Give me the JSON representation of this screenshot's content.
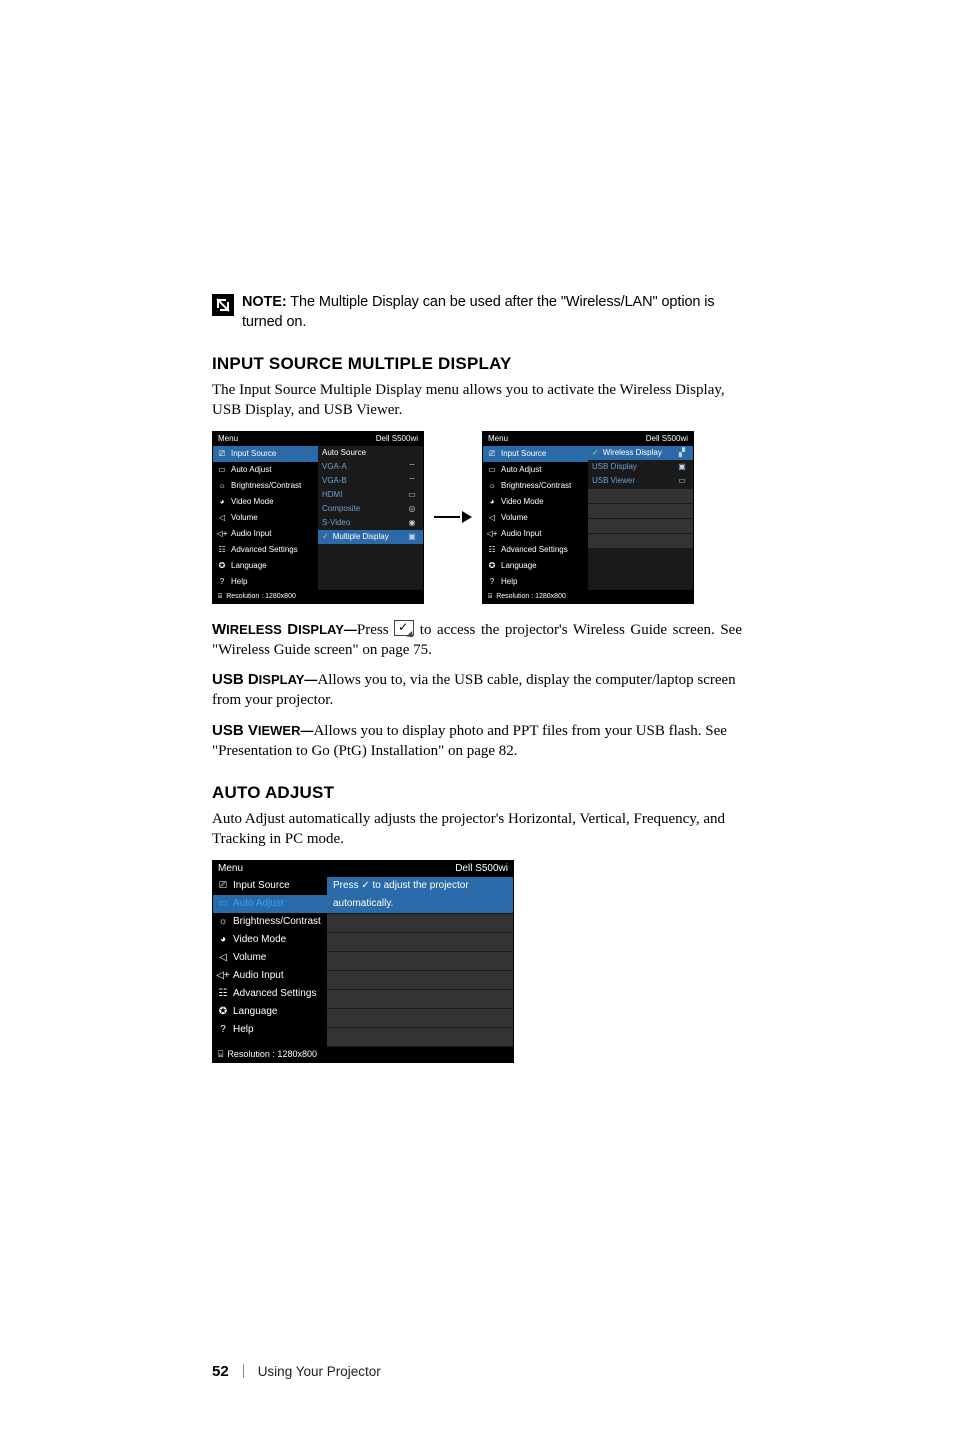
{
  "note": {
    "label": "NOTE:",
    "text": " The Multiple Display can be used after the \"Wireless/LAN\" option is turned on."
  },
  "section1": {
    "heading": "INPUT SOURCE MULTIPLE DISPLAY",
    "para": "The Input Source Multiple Display menu allows you to activate the Wireless Display, USB Display, and USB Viewer."
  },
  "osd_common": {
    "menu_title": "Menu",
    "model": "Dell  S500wi",
    "resolution": "Resolution : 1280x800",
    "sidebar": [
      "Input Source",
      "Auto Adjust",
      "Brightness/Contrast",
      "Video Mode",
      "Volume",
      "Audio Input",
      "Advanced Settings",
      "Language",
      "Help"
    ]
  },
  "osd_left": {
    "items": [
      {
        "label": "Auto Source",
        "type": "head"
      },
      {
        "label": "VGA-A"
      },
      {
        "label": "VGA-B"
      },
      {
        "label": "HDMI"
      },
      {
        "label": "Composite"
      },
      {
        "label": "S-Video"
      },
      {
        "label": "Multiple Display",
        "selected": true
      }
    ]
  },
  "osd_right": {
    "items": [
      {
        "label": "Wireless Display",
        "selected": true
      },
      {
        "label": "USB Display"
      },
      {
        "label": "USB Viewer"
      }
    ]
  },
  "wireless": {
    "label_cap_w": "W",
    "label_rest_w": "IRELESS",
    "label_cap_d": "D",
    "label_rest_d": "ISPLAY—",
    "before": "Press ",
    "after": " to access the projector's Wireless Guide screen. See \"Wireless Guide screen\" on page 75."
  },
  "usb_display": {
    "label_cap_u": "USB D",
    "label_rest": "ISPLAY—",
    "text": "Allows you to, via the USB cable, display the computer/laptop screen from your projector."
  },
  "usb_viewer": {
    "label_cap": "USB V",
    "label_rest": "IEWER—",
    "text": "Allows you to display photo and PPT files from your USB flash. See \"Presentation to Go (PtG) Installation\" on page 82."
  },
  "section2": {
    "heading": "AUTO ADJUST",
    "para": "Auto Adjust automatically adjusts the projector's Horizontal, Vertical, Frequency, and Tracking in PC mode."
  },
  "osd_auto": {
    "text1": "Press  ✓  to adjust the projector",
    "text2": "automatically."
  },
  "footer": {
    "page": "52",
    "label": "Using Your Projector"
  }
}
